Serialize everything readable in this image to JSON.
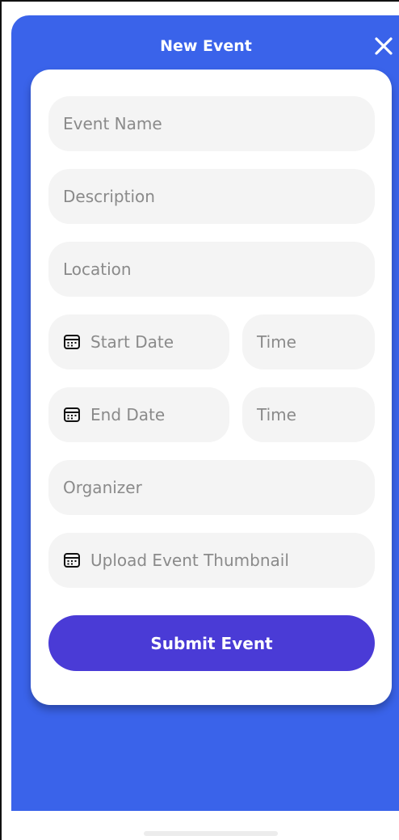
{
  "header": {
    "title": "New Event"
  },
  "form": {
    "event_name_placeholder": "Event Name",
    "description_placeholder": "Description",
    "location_placeholder": "Location",
    "start_date_placeholder": "Start Date",
    "start_time_placeholder": "Time",
    "end_date_placeholder": "End Date",
    "end_time_placeholder": "Time",
    "organizer_placeholder": "Organizer",
    "thumbnail_placeholder": "Upload Event Thumbnail",
    "submit_label": "Submit Event"
  },
  "icons": {
    "close": "close-icon",
    "calendar": "calendar-icon"
  },
  "colors": {
    "panel_blue": "#3a63ea",
    "submit_purple": "#4a3bd6",
    "field_bg": "#f4f4f4",
    "placeholder_text": "#8a8a8a"
  }
}
